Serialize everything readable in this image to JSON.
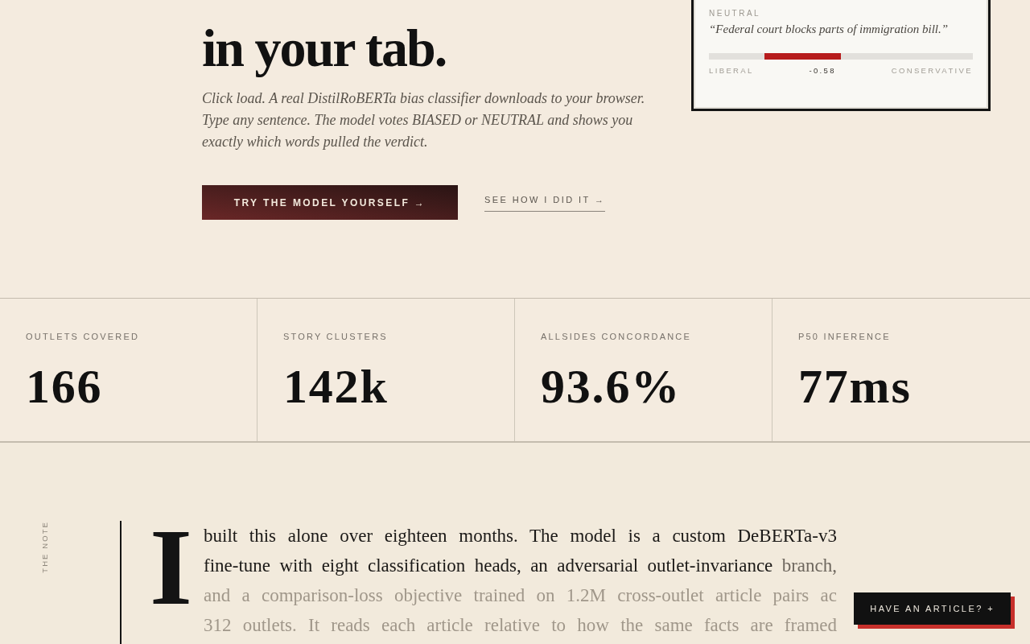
{
  "hero": {
    "headline": "in your tab.",
    "intro": "Click load. A real DistilRoBERTa bias classifier downloads to your browser. Type any sentence. The model votes BIASED or NEUTRAL and shows you exactly which words pulled the verdict.",
    "primary_button": "TRY THE MODEL YOURSELF →",
    "secondary_link": "SEE HOW I DID IT →"
  },
  "example_card": {
    "label": "NEUTRAL",
    "quote": "“Federal court blocks parts of immigration bill.”",
    "meter": {
      "leans_left": true,
      "level": 0.58
    },
    "scale_left": "LIBERAL",
    "score": "-0.58",
    "scale_right": "CONSERVATIVE"
  },
  "stats": [
    {
      "label": "OUTLETS COVERED",
      "value": "166"
    },
    {
      "label": "STORY CLUSTERS",
      "value": "142k"
    },
    {
      "label": "ALLSIDES CONCORDANCE",
      "value": "93.6%"
    },
    {
      "label": "P50 INFERENCE",
      "value": "77ms"
    }
  ],
  "note": {
    "side_label": "THE NOTE",
    "drop_cap": "I",
    "segments": [
      {
        "text": "built this alone over eighteen months. The model is a custom DeBERTa-v3 fine-tune with eight classification heads, an adversarial outlet-invariance",
        "kind": "read"
      },
      {
        "text": "branch,",
        "kind": "current"
      },
      {
        "text": "and a comparison-loss objective trained on 1.2M cross-outlet article pairs ac 312 outlets. It reads each article relative to how the same facts are framed",
        "kind": "unread"
      }
    ]
  },
  "floating_button": "HAVE AN ARTICLE? +"
}
